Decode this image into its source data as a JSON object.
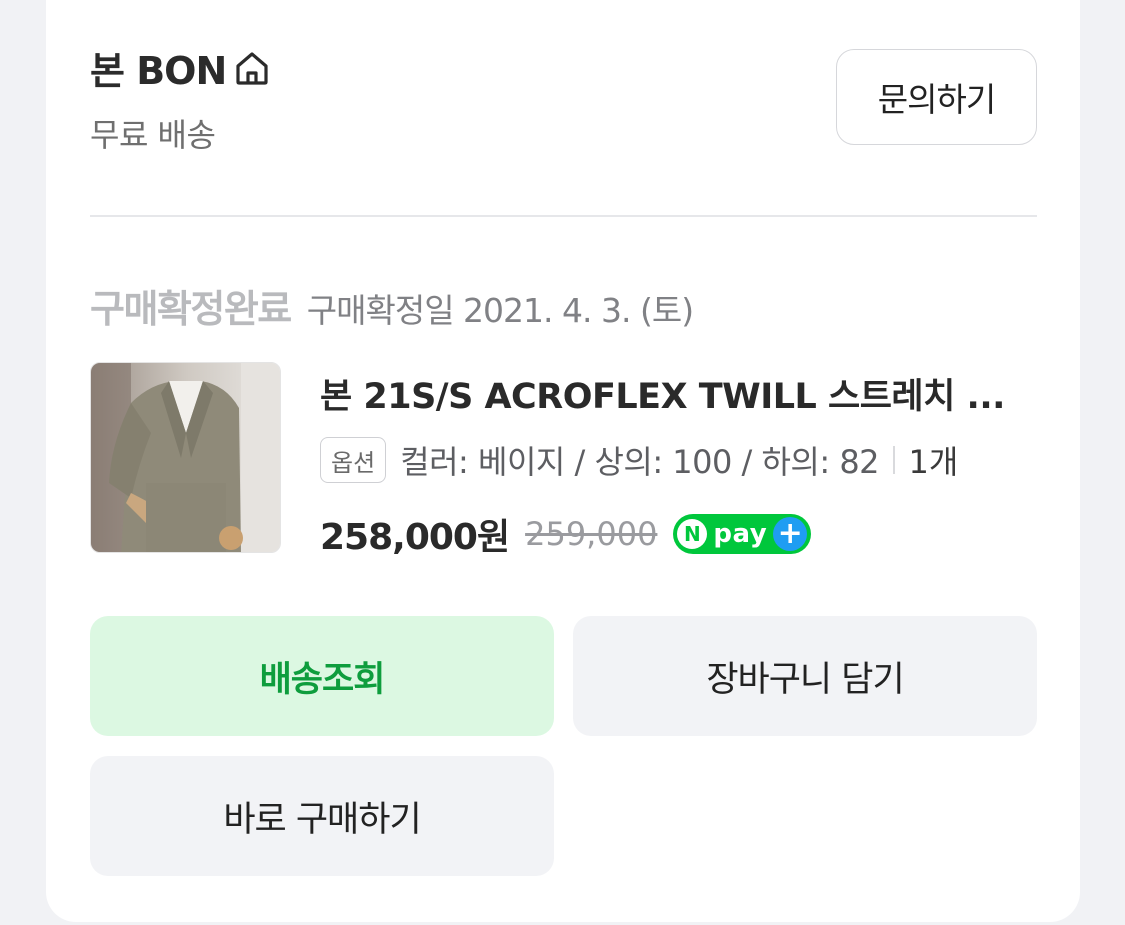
{
  "store": {
    "name": "본 BON",
    "shipping": "무료 배송",
    "inquiry_label": "문의하기"
  },
  "order": {
    "status": "구매확정완료",
    "confirm_date": "구매확정일 2021. 4. 3. (토)"
  },
  "product": {
    "title": "본 21S/S ACROFLEX TWILL 스트레치 ...",
    "option_badge": "옵션",
    "option_text": "컬러: 베이지 / 상의: 100 / 하의: 82",
    "quantity": "1개",
    "price": "258,000원",
    "original_price": "259,000",
    "npay_n": "N",
    "npay_text": "pay",
    "npay_plus": "+"
  },
  "actions": {
    "track_label": "배송조회",
    "cart_label": "장바구니 담기",
    "buy_label": "바로 구매하기"
  },
  "colors": {
    "accent_green": "#0e9d3d",
    "track_bg": "#dcf8e2",
    "npay_green": "#00c73c",
    "npay_blue": "#1f9df2"
  }
}
